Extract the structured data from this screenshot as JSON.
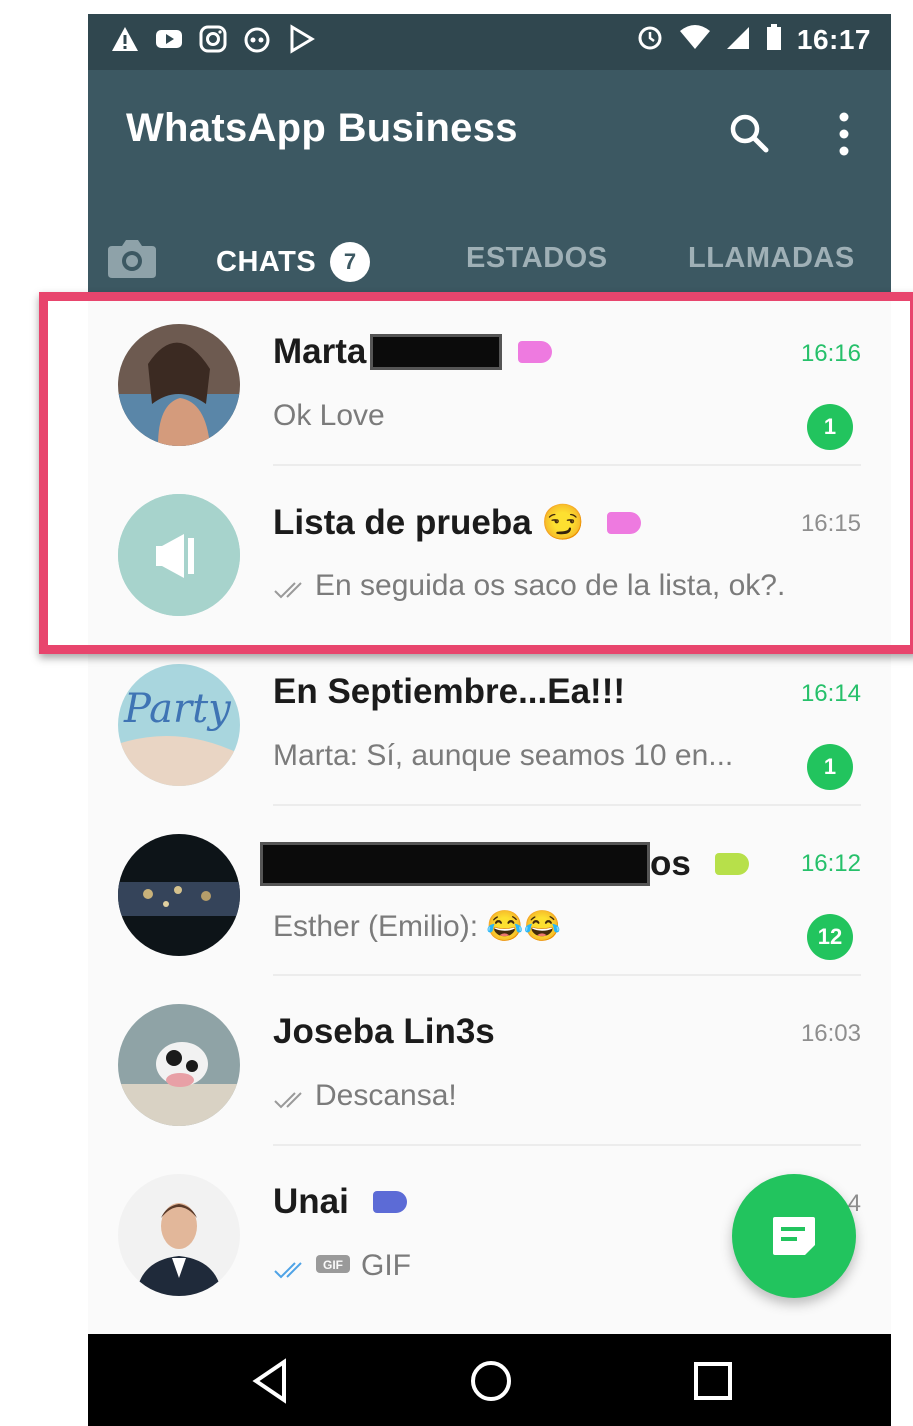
{
  "status_bar": {
    "time": "16:17",
    "left_icons": [
      "warning-icon",
      "youtube-icon",
      "instagram-icon",
      "headset-icon",
      "play-store-icon"
    ],
    "right_icons": [
      "alarm-icon",
      "wifi-icon",
      "signal-icon",
      "battery-icon"
    ]
  },
  "app_bar": {
    "title": "WhatsApp Business",
    "actions": [
      "search-icon",
      "more-vert-icon"
    ]
  },
  "tabs": {
    "camera_icon": "camera-icon",
    "chats": {
      "label": "CHATS",
      "badge": "7"
    },
    "estados": {
      "label": "ESTADOS"
    },
    "llamadas": {
      "label": "LLAMADAS"
    }
  },
  "chats": [
    {
      "name": "Marta",
      "time": "16:16",
      "preview": "Ok Love",
      "unread": "1",
      "label_color": "#ee7ae0",
      "avatar": "photo"
    },
    {
      "name": "Lista de prueba 😏",
      "time": "16:15",
      "preview": "En seguida os saco de la lista, ok?...",
      "unread": "",
      "label_color": "#ee7ae0",
      "avatar": "broadcast-icon"
    },
    {
      "name": "En Septiembre...Ea!!!",
      "time": "16:14",
      "preview": "Marta: Sí, aunque seamos 10 en...",
      "unread": "1",
      "label_color": "",
      "avatar": "photo"
    },
    {
      "name": "os",
      "time": "16:12",
      "preview": "Esther (Emilio): 😂😂",
      "unread": "12",
      "label_color": "#b7e04a",
      "avatar": "photo"
    },
    {
      "name": "Joseba Lin3s",
      "time": "16:03",
      "preview": "Descansa!",
      "unread": "",
      "label_color": "",
      "avatar": "photo"
    },
    {
      "name": "Unai",
      "time": "4",
      "preview": "GIF",
      "unread": "",
      "label_color": "#5c6bd6",
      "avatar": "photo"
    }
  ],
  "fab": {
    "icon": "new-chat-icon"
  },
  "nav_bar": {
    "icons": [
      "back-icon",
      "home-icon",
      "recents-icon"
    ]
  },
  "colors": {
    "toolbar": "#3c5862",
    "statusbar": "#30474f",
    "accent_green": "#22c45e",
    "highlight_border": "#e8456d"
  }
}
